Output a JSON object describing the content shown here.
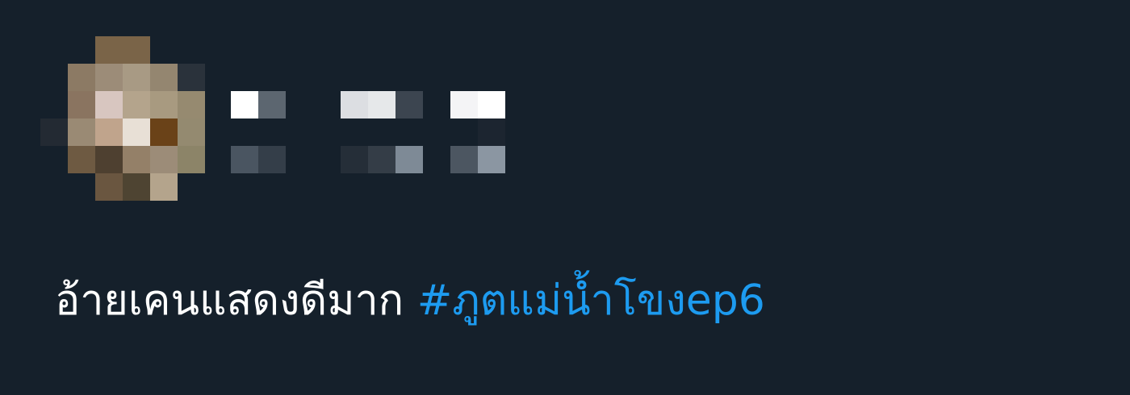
{
  "tweet": {
    "text": "อ้ายเคนแสดงดีมาก ",
    "hashtag": "#ภูตแม่น้ำโขงep6"
  },
  "colors": {
    "background": "#15202b",
    "text": "#ffffff",
    "link": "#1d9bf0"
  },
  "avatar": {
    "pixels": [
      "#15202b",
      "#15202b",
      "#7a6448",
      "#7a6448",
      "#15202b",
      "#15202b",
      "#15202b",
      "#8c7a64",
      "#9c8c78",
      "#a89a84",
      "#948670",
      "#2a323b",
      "#15202b",
      "#8a7460",
      "#d8c6c0",
      "#b4a48c",
      "#a89a80",
      "#968a70",
      "#232a33",
      "#9a8a74",
      "#c0a48c",
      "#e8e0d6",
      "#6a4218",
      "#948a70",
      "#15202b",
      "#6e5a42",
      "#4e4030",
      "#948068",
      "#9c8c78",
      "#8c8468",
      "#15202b",
      "#15202b",
      "#6a5640",
      "#4e4432",
      "#b4a48c",
      "#15202b"
    ]
  },
  "name_block": {
    "pixels": [
      "#ffffff",
      "#5c6670",
      "#15202b",
      "#15202b",
      "#dcdee2",
      "#e6e8ea",
      "#3c4550",
      "#15202b",
      "#f4f4f6",
      "#ffffff",
      "#15202b",
      "#15202b",
      "#15202b",
      "#15202b",
      "#15202b",
      "#15202b",
      "#15202b",
      "#15202b",
      "#15202b",
      "#1c2530",
      "#4a5561",
      "#343e49",
      "#15202b",
      "#15202b",
      "#252e38",
      "#343d47",
      "#7e8a96",
      "#15202b",
      "#4c5661",
      "#8b96a2"
    ]
  }
}
